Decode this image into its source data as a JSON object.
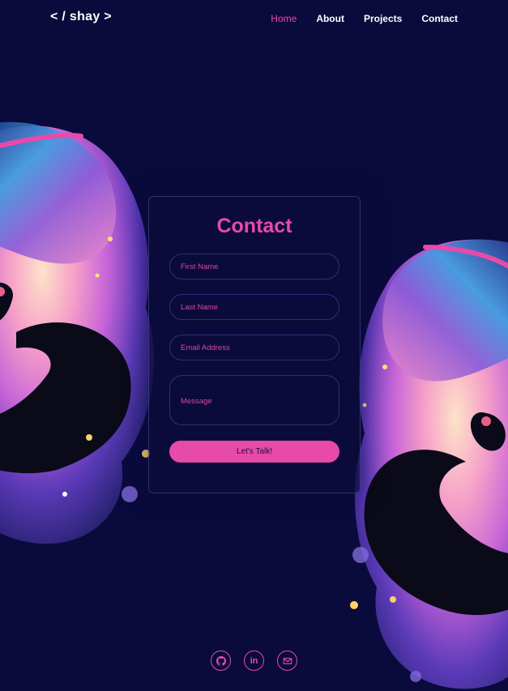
{
  "header": {
    "logo": "< / shay >",
    "nav": [
      {
        "label": "Home",
        "active": true
      },
      {
        "label": "About",
        "active": false
      },
      {
        "label": "Projects",
        "active": false
      },
      {
        "label": "Contact",
        "active": false
      }
    ]
  },
  "contact": {
    "title": "Contact",
    "fields": {
      "first_name": "First Name",
      "last_name": "Last Name",
      "email": "Email Address",
      "message": "Message"
    },
    "submit_label": "Let's Talk!"
  },
  "socials": {
    "items": [
      "github-icon",
      "linkedin-icon",
      "mail-icon"
    ],
    "linkedin_text": "in"
  },
  "colors": {
    "background": "#0a0a3c",
    "accent": "#e84aa9",
    "text": "#ffffff"
  }
}
